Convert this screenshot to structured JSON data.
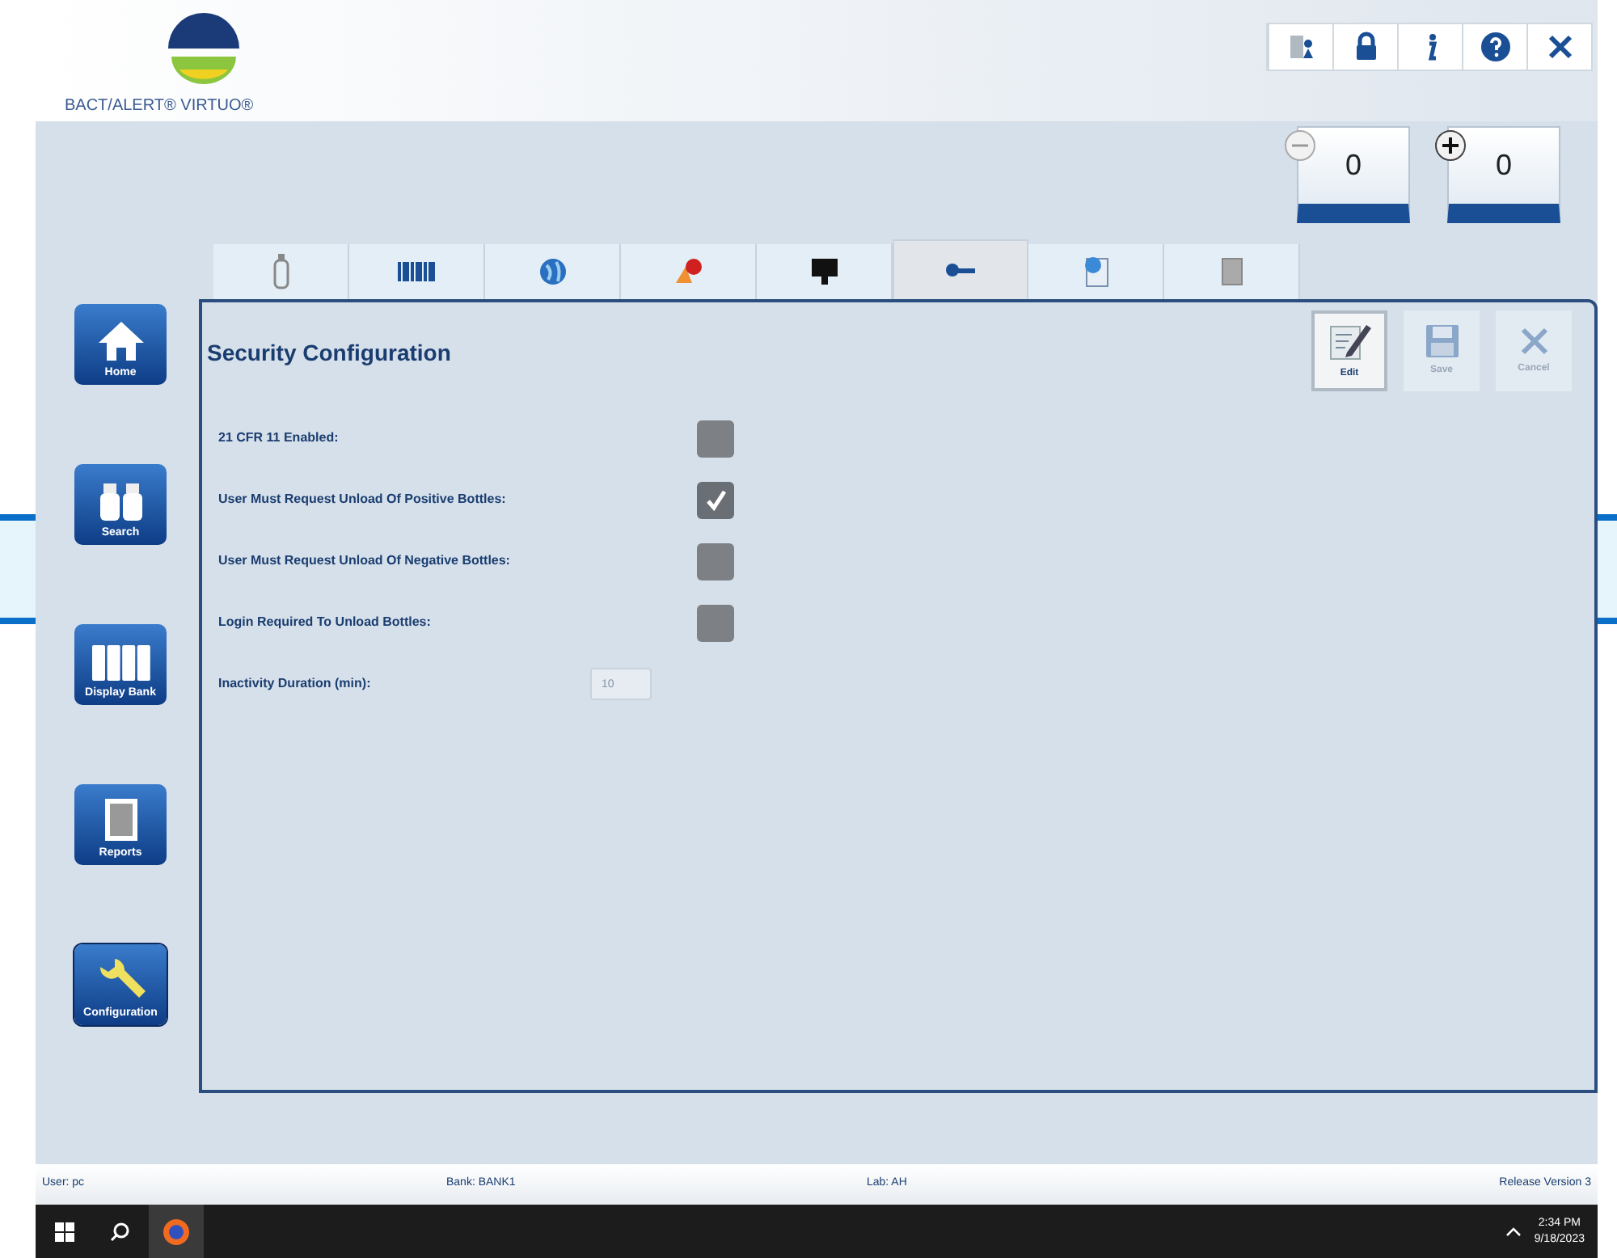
{
  "header": {
    "logo_text": "BACT/ALERT® VIRTUO®"
  },
  "counters": [
    {
      "kind": "minus",
      "value": "0"
    },
    {
      "kind": "plus",
      "value": "0"
    }
  ],
  "sidebar": [
    {
      "kind": "home",
      "label": "Home",
      "selected": false
    },
    {
      "kind": "search",
      "label": "Search",
      "selected": false
    },
    {
      "kind": "bank",
      "label": "Display Bank",
      "selected": false
    },
    {
      "kind": "reports",
      "label": "Reports",
      "selected": false
    },
    {
      "kind": "config",
      "label": "Configuration",
      "selected": true
    }
  ],
  "tabs": [
    {
      "kind": "bottle",
      "selected": false
    },
    {
      "kind": "barcode",
      "selected": false
    },
    {
      "kind": "globe",
      "selected": false
    },
    {
      "kind": "alert",
      "selected": false
    },
    {
      "kind": "monitor",
      "selected": false
    },
    {
      "kind": "key",
      "selected": true
    },
    {
      "kind": "document",
      "selected": false
    },
    {
      "kind": "tablet",
      "selected": false
    }
  ],
  "panel": {
    "title": "Security Configuration",
    "actions": [
      {
        "kind": "edit",
        "label": "Edit",
        "disabled": false
      },
      {
        "kind": "save",
        "label": "Save",
        "disabled": true
      },
      {
        "kind": "cancel",
        "label": "Cancel",
        "disabled": true
      }
    ],
    "settings": [
      {
        "kind": "checkbox",
        "label": "21 CFR 11 Enabled:",
        "checked": false
      },
      {
        "kind": "checkbox",
        "label": "User Must Request Unload Of Positive Bottles:",
        "checked": true
      },
      {
        "kind": "checkbox",
        "label": "User Must Request Unload Of Negative Bottles:",
        "checked": false
      },
      {
        "kind": "checkbox",
        "label": "Login Required To Unload Bottles:",
        "checked": false
      },
      {
        "kind": "number",
        "label": "Inactivity Duration (min):",
        "value": "10"
      }
    ]
  },
  "status_bar": {
    "user": "User: pc",
    "bank": "Bank: BANK1",
    "lab": "Lab: AH",
    "version": "Release Version 3"
  },
  "taskbar": {
    "time": "2:34 PM",
    "date": "9/18/2023"
  }
}
